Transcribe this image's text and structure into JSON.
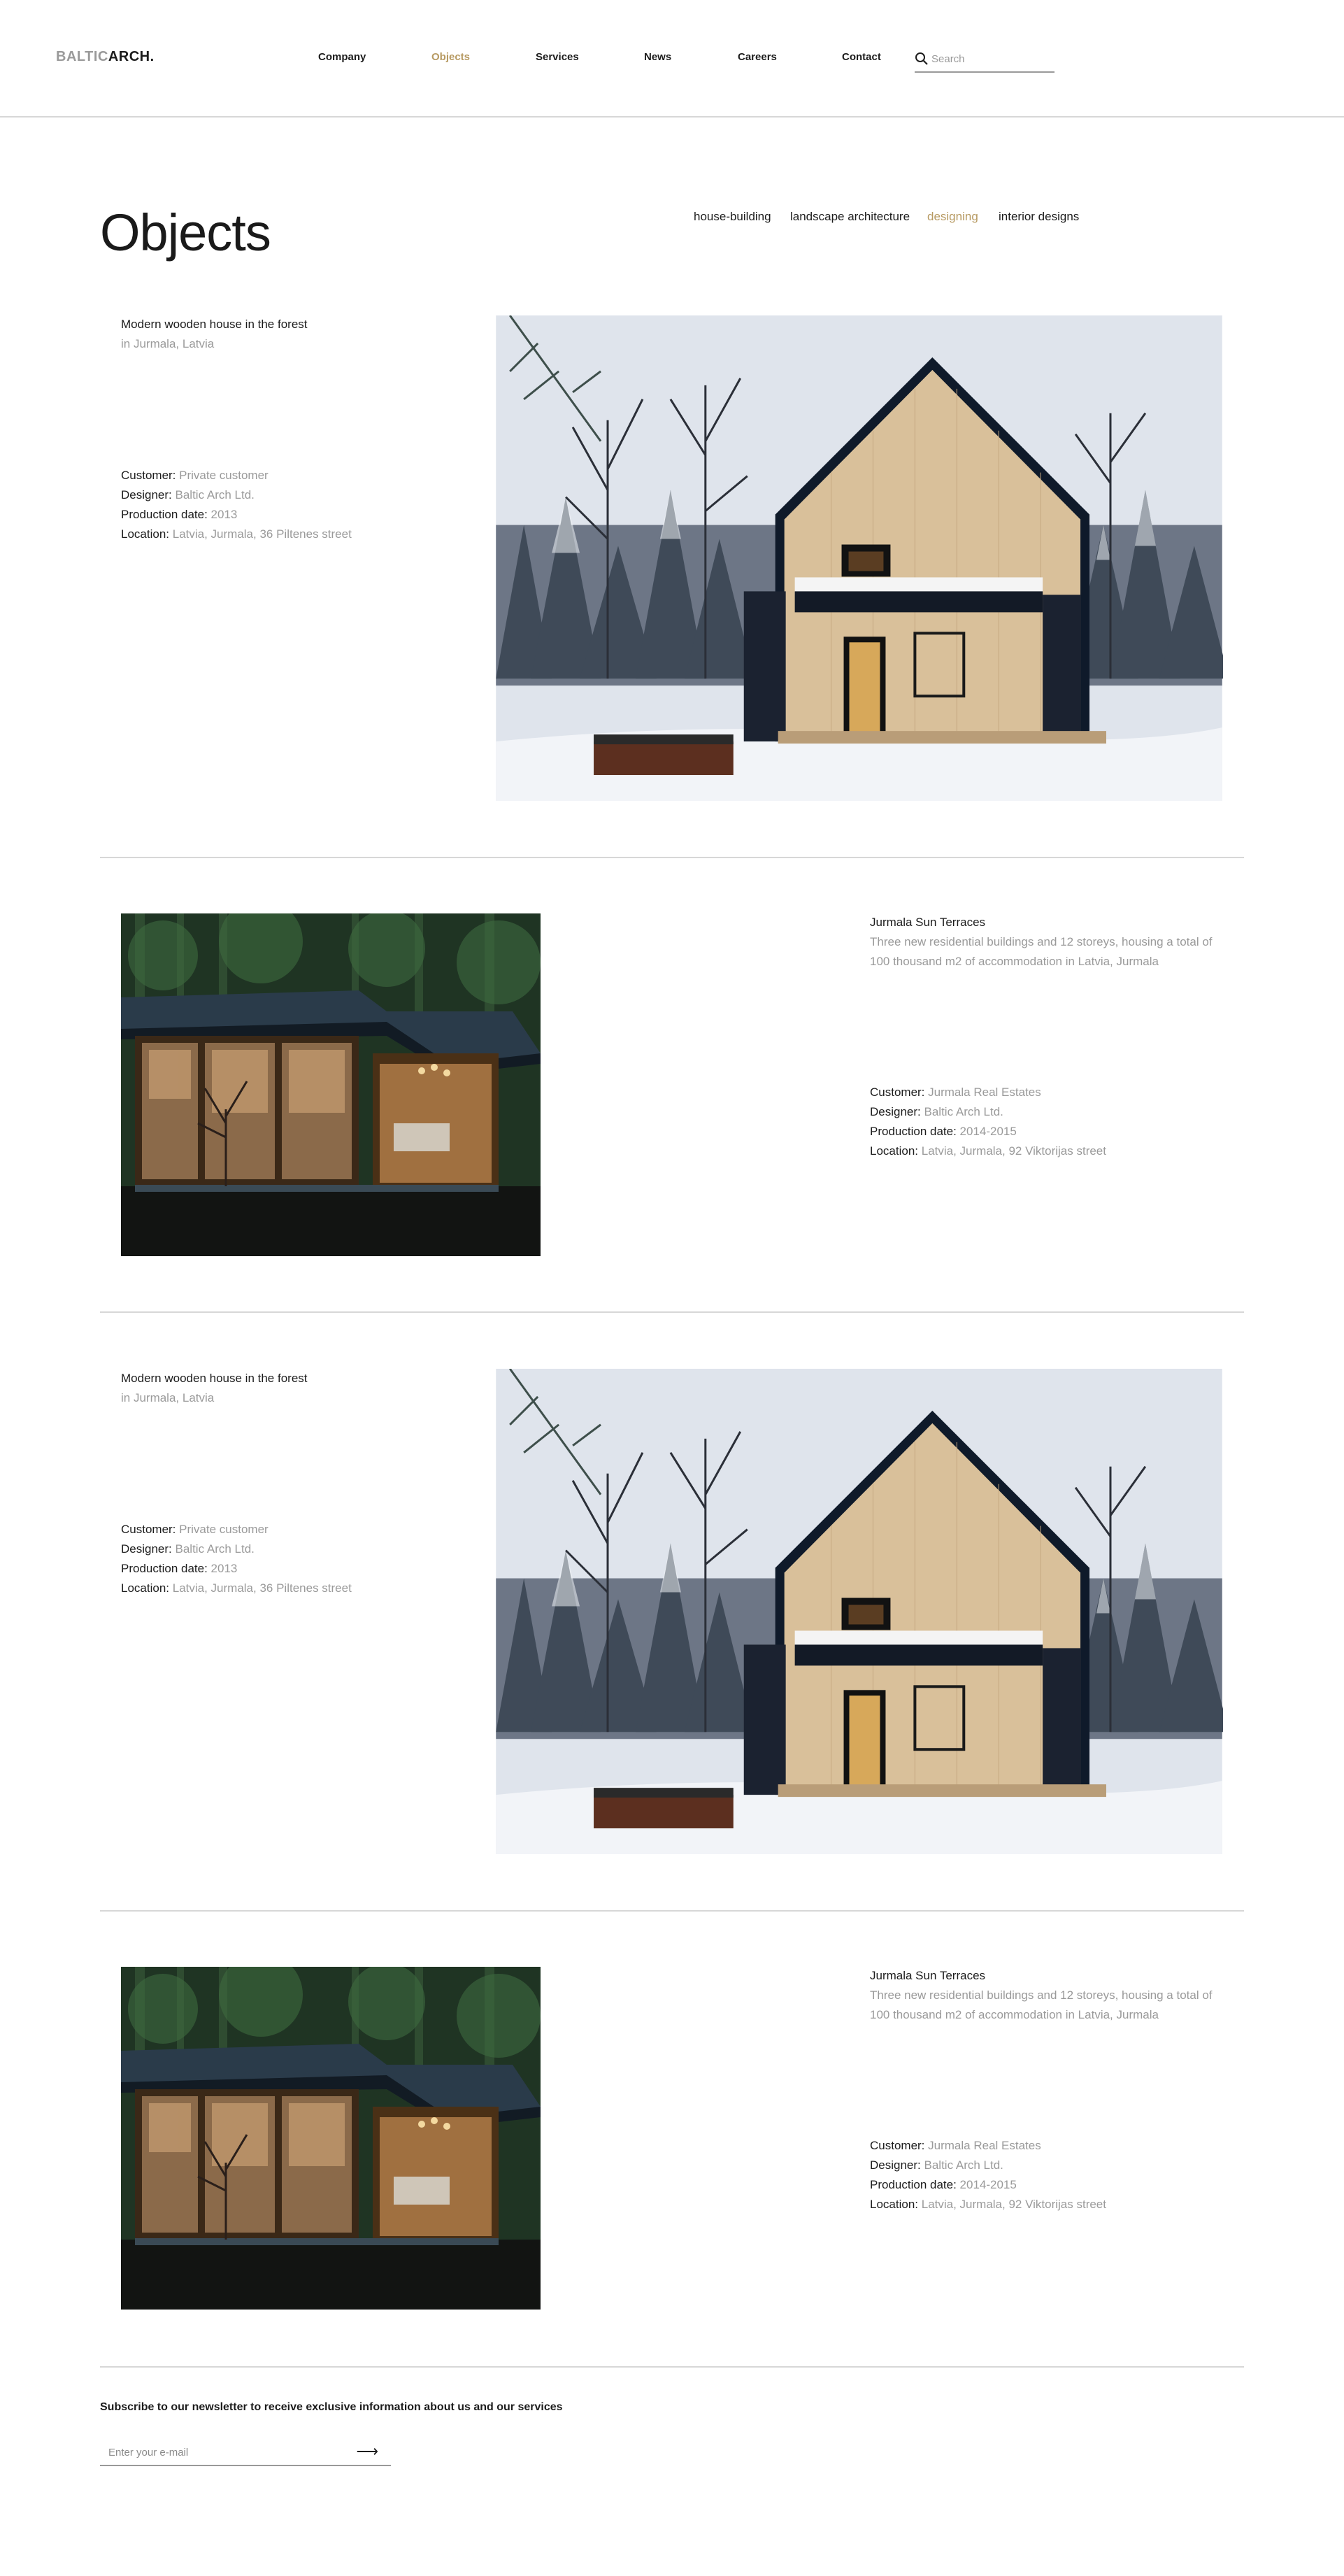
{
  "header": {
    "logo_part1": "BALTIC",
    "logo_part2": "ARCH.",
    "nav": [
      {
        "label": "Company",
        "active": false
      },
      {
        "label": "Objects",
        "active": true
      },
      {
        "label": "Services",
        "active": false
      },
      {
        "label": "News",
        "active": false
      },
      {
        "label": "Careers",
        "active": false
      },
      {
        "label": "Contact",
        "active": false
      }
    ],
    "search_placeholder": "Search"
  },
  "page": {
    "title": "Objects",
    "filters": [
      {
        "label": "house-building",
        "active": false
      },
      {
        "label": "landscape architecture",
        "active": false
      },
      {
        "label": "designing",
        "active": true
      },
      {
        "label": "interior designs",
        "active": false
      }
    ]
  },
  "objects": [
    {
      "name": "Modern wooden house in the forest",
      "subtitle": "in Jurmala, Latvia",
      "customer_label": "Customer:",
      "customer": "Private customer",
      "designer_label": "Designer:",
      "designer": "Baltic Arch Ltd.",
      "date_label": "Production date:",
      "date": "2013",
      "location_label": "Location:",
      "location": "Latvia, Jurmala, 36 Piltenes street",
      "image": "snowy-cabin-photo"
    },
    {
      "name": "Jurmala Sun Terraces",
      "subtitle": "Three new residential buildings and 12 storeys, housing a total of 100 thousand m2 of accommodation in Latvia, Jurmala",
      "customer_label": "Customer:",
      "customer": "Jurmala Real Estates",
      "designer_label": "Designer:",
      "designer": "Baltic Arch Ltd.",
      "date_label": "Production date:",
      "date": "2014-2015",
      "location_label": "Location:",
      "location": "Latvia, Jurmala, 92 Viktorijas street",
      "image": "glass-pavilion-photo"
    },
    {
      "name": "Modern wooden house in the forest",
      "subtitle": "in Jurmala, Latvia",
      "customer_label": "Customer:",
      "customer": "Private customer",
      "designer_label": "Designer:",
      "designer": "Baltic Arch Ltd.",
      "date_label": "Production date:",
      "date": "2013",
      "location_label": "Location:",
      "location": "Latvia, Jurmala, 36 Piltenes street",
      "image": "snowy-cabin-photo"
    },
    {
      "name": "Jurmala Sun Terraces",
      "subtitle": "Three new residential buildings and 12 storeys, housing a total of 100 thousand m2 of accommodation in Latvia, Jurmala",
      "customer_label": "Customer:",
      "customer": "Jurmala Real Estates",
      "designer_label": "Designer:",
      "designer": "Baltic Arch Ltd.",
      "date_label": "Production date:",
      "date": "2014-2015",
      "location_label": "Location:",
      "location": "Latvia, Jurmala, 92 Viktorijas street",
      "image": "glass-pavilion-photo"
    }
  ],
  "newsletter": {
    "title": "Subscribe to our newsletter to receive exclusive information about us and our services",
    "placeholder": "Enter your e-mail",
    "submit_icon": "arrow-right-icon"
  },
  "colors": {
    "accent": "#b79a62",
    "text": "#1c1c1c",
    "muted": "#9a9a9a",
    "divider": "#d7d7d7"
  }
}
